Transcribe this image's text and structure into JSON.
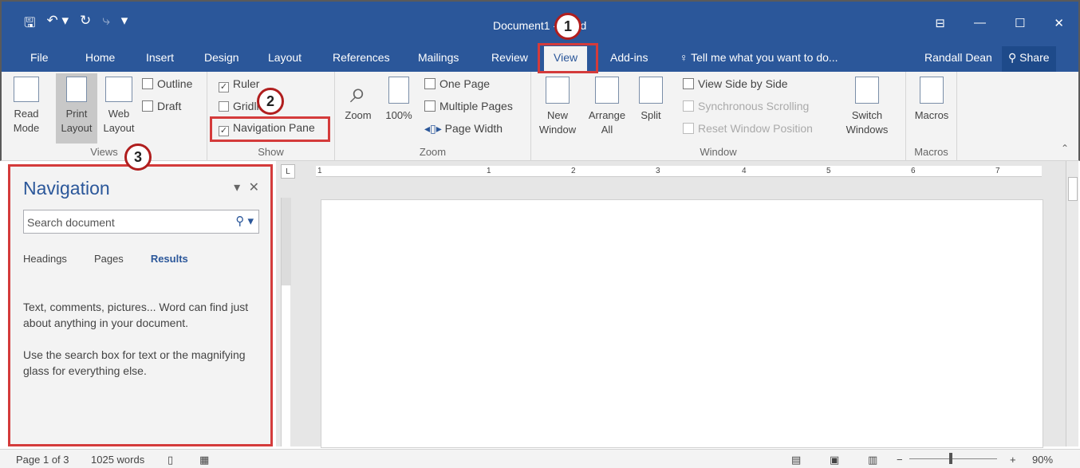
{
  "window": {
    "title": "Document1 - Word"
  },
  "qat": {
    "save": "🖫",
    "undo": "↶ ▾",
    "redo": "↻",
    "repeat": "⤷",
    "customize": "▾"
  },
  "window_controls": {
    "ribbon_options": "⊟",
    "minimize": "—",
    "maximize": "☐",
    "close": "✕"
  },
  "tabs": [
    "File",
    "Home",
    "Insert",
    "Design",
    "Layout",
    "References",
    "Mailings",
    "Review",
    "View",
    "Add-ins"
  ],
  "active_tab": "View",
  "tell_me": "Tell me what you want to do...",
  "user": "Randall Dean",
  "share": "Share",
  "ribbon": {
    "views": {
      "label": "Views",
      "read_mode": [
        "Read",
        "Mode"
      ],
      "print_layout": [
        "Print",
        "Layout"
      ],
      "web_layout": [
        "Web",
        "Layout"
      ],
      "outline": "Outline",
      "draft": "Draft"
    },
    "show": {
      "label": "Show",
      "ruler": "Ruler",
      "gridlines": "Gridlines",
      "navigation_pane": "Navigation Pane"
    },
    "zoom": {
      "label": "Zoom",
      "zoom": "Zoom",
      "hundred": "100%",
      "one_page": "One Page",
      "multiple_pages": "Multiple Pages",
      "page_width": "Page Width"
    },
    "window": {
      "label": "Window",
      "new_window": [
        "New",
        "Window"
      ],
      "arrange_all": [
        "Arrange",
        "All"
      ],
      "split": "Split",
      "side_by_side": "View Side by Side",
      "sync_scrolling": "Synchronous Scrolling",
      "reset_position": "Reset Window Position",
      "switch_windows": [
        "Switch",
        "Windows"
      ]
    },
    "macros": {
      "label": "Macros",
      "macros": "Macros"
    }
  },
  "navigation": {
    "title": "Navigation",
    "search_placeholder": "Search document",
    "tabs": [
      "Headings",
      "Pages",
      "Results"
    ],
    "active_tab": "Results",
    "text1": "Text, comments, pictures... Word can find just about anything in your document.",
    "text2": "Use the search box for text or the magnifying glass for everything else."
  },
  "ruler": {
    "numbers": [
      "1",
      "1",
      "2",
      "3",
      "4",
      "5",
      "6",
      "7"
    ]
  },
  "status": {
    "page": "Page 1 of 3",
    "words": "1025 words",
    "zoom": "90%"
  },
  "callouts": [
    "1",
    "2",
    "3"
  ],
  "colors": {
    "accent": "#2b579a",
    "callout": "#d43b3b"
  }
}
